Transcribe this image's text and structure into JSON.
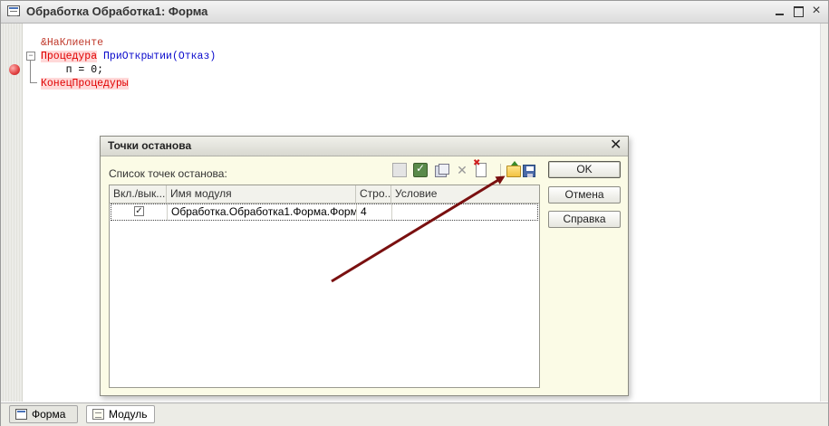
{
  "window": {
    "title": "Обработка Обработка1: Форма",
    "minimize_icon": "minimize-icon",
    "maximize_icon": "maximize-icon",
    "close_icon": "close-icon"
  },
  "code": {
    "lines": [
      [
        {
          "text": "&НаКлиенте",
          "cls": "kw-dir"
        }
      ],
      [
        {
          "text": "Процедура",
          "cls": "kw"
        },
        {
          "text": " ",
          "cls": "plain"
        },
        {
          "text": "ПриОткрытии(Отказ)",
          "cls": "ident"
        }
      ],
      [
        {
          "text": "    п = 0;",
          "cls": "plain"
        }
      ],
      [
        {
          "text": "КонецПроцедуры",
          "cls": "kw"
        }
      ]
    ]
  },
  "tabs": [
    {
      "label": "Форма",
      "icon": "form-icon"
    },
    {
      "label": "Модуль",
      "icon": "module-icon"
    }
  ],
  "dialog": {
    "title": "Точки останова",
    "list_label": "Список точек останова:",
    "toolbar": [
      "goto-icon",
      "enable-all-icon",
      "disable-all-icon",
      "delete-icon",
      "delete-all-icon",
      "load-folder-icon",
      "save-icon"
    ],
    "columns": [
      "Вкл./вык...",
      "Имя модуля",
      "Стро...",
      "Условие"
    ],
    "rows": [
      {
        "enabled": true,
        "module": "Обработка.Обработка1.Форма.Форм...",
        "line": "4",
        "condition": ""
      }
    ],
    "buttons": {
      "ok": "OK",
      "cancel": "Отмена",
      "help": "Справка"
    }
  },
  "annotation": {
    "color": "#7a1010"
  }
}
